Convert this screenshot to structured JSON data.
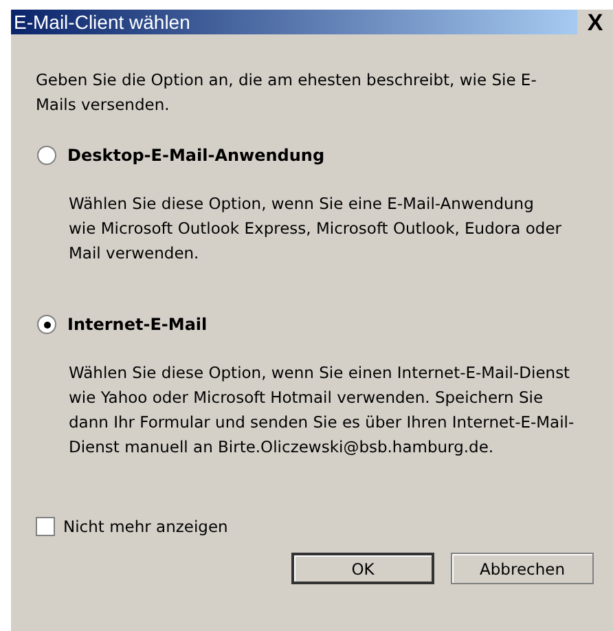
{
  "window": {
    "title": "E-Mail-Client wählen",
    "close": "X"
  },
  "intro": "Geben Sie die Option an, die am ehesten beschreibt, wie Sie E-Mails versenden.",
  "options": [
    {
      "label": "Desktop-E-Mail-Anwendung",
      "selected": false,
      "description": "Wählen Sie diese Option, wenn Sie eine E-Mail-Anwendung wie Microsoft Outlook Express, Microsoft Outlook, Eudora oder Mail verwenden."
    },
    {
      "label": "Internet-E-Mail",
      "selected": true,
      "description": "Wählen Sie diese Option, wenn Sie einen Internet-E-Mail-Dienst wie Yahoo oder Microsoft Hotmail verwenden. Speichern Sie dann Ihr Formular und senden Sie es über Ihren Internet-E-Mail-Dienst manuell an Birte.Oliczewski@bsb.hamburg.de."
    }
  ],
  "dont_show_again": {
    "label": "Nicht mehr anzeigen",
    "checked": false
  },
  "buttons": [
    {
      "label": "OK",
      "default": true
    },
    {
      "label": "Abbrechen",
      "default": false
    }
  ]
}
